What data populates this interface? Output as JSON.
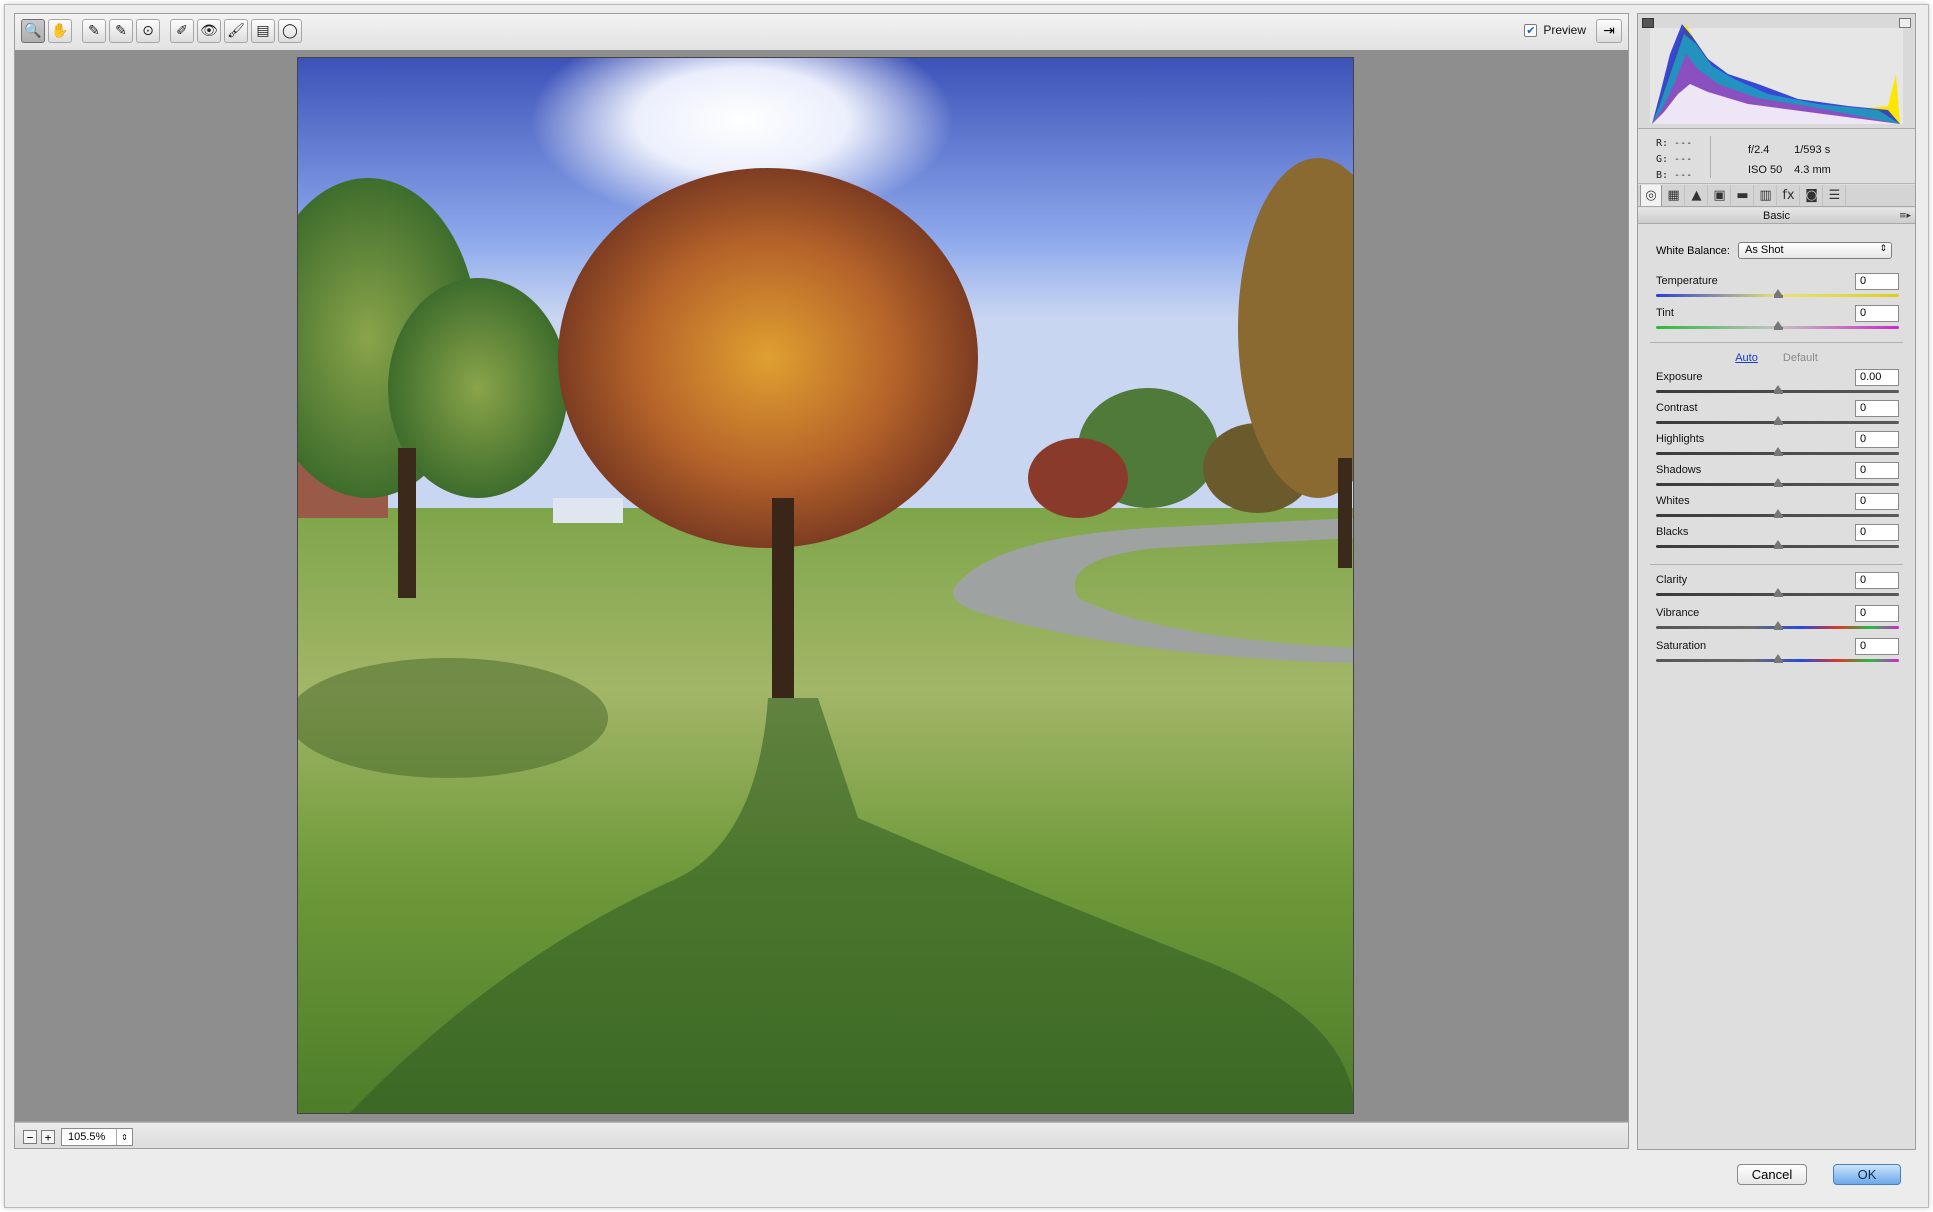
{
  "toolbar": {
    "tools": [
      {
        "name": "zoom-tool",
        "glyph": "🔍"
      },
      {
        "name": "hand-tool",
        "glyph": "✋"
      },
      {
        "name": "white-balance-tool",
        "glyph": "✎"
      },
      {
        "name": "color-sampler-tool",
        "glyph": "✎"
      },
      {
        "name": "targeted-adjustment-tool",
        "glyph": "⊙"
      },
      {
        "name": "spot-removal-tool",
        "glyph": "✐"
      },
      {
        "name": "red-eye-tool",
        "glyph": "👁"
      },
      {
        "name": "adjustment-brush-tool",
        "glyph": "🖌"
      },
      {
        "name": "graduated-filter-tool",
        "glyph": "▤"
      },
      {
        "name": "radial-filter-tool",
        "glyph": "◯"
      }
    ],
    "preview_label": "Preview",
    "preview_checked": "✔",
    "fullscreen_glyph": "⇥"
  },
  "zoom": {
    "value": "105.5%",
    "zoom_out": "−",
    "zoom_in": "+"
  },
  "info": {
    "r": "R:  ---",
    "g": "G:  ---",
    "b": "B:  ---",
    "aperture": "f/2.4",
    "shutter": "1/593 s",
    "iso": "ISO 50",
    "focal": "4.3 mm"
  },
  "panel": {
    "tabs": [
      "◎",
      "▦",
      "▲",
      "▣",
      "▬",
      "▥",
      "fx",
      "◙",
      "☰"
    ],
    "title": "Basic",
    "menu_glyph": "≡▸",
    "white_balance_label": "White Balance:",
    "white_balance_value": "As Shot",
    "auto_label": "Auto",
    "default_label": "Default",
    "sliders": [
      {
        "label": "Temperature",
        "value": "0",
        "position": 0.5,
        "track": "temperature"
      },
      {
        "label": "Tint",
        "value": "0",
        "position": 0.5,
        "track": "tint"
      },
      {
        "label": "Exposure",
        "value": "0.00",
        "position": 0.5,
        "track": "dark"
      },
      {
        "label": "Contrast",
        "value": "0",
        "position": 0.5,
        "track": "dark"
      },
      {
        "label": "Highlights",
        "value": "0",
        "position": 0.5,
        "track": "dark"
      },
      {
        "label": "Shadows",
        "value": "0",
        "position": 0.5,
        "track": "dark"
      },
      {
        "label": "Whites",
        "value": "0",
        "position": 0.5,
        "track": "dark"
      },
      {
        "label": "Blacks",
        "value": "0",
        "position": 0.5,
        "track": "dark"
      },
      {
        "label": "Clarity",
        "value": "0",
        "position": 0.5,
        "track": "dark"
      },
      {
        "label": "Vibrance",
        "value": "0",
        "position": 0.5,
        "track": "spectrum"
      },
      {
        "label": "Saturation",
        "value": "0",
        "position": 0.5,
        "track": "spectrum"
      }
    ]
  },
  "buttons": {
    "cancel": "Cancel",
    "ok": "OK"
  }
}
